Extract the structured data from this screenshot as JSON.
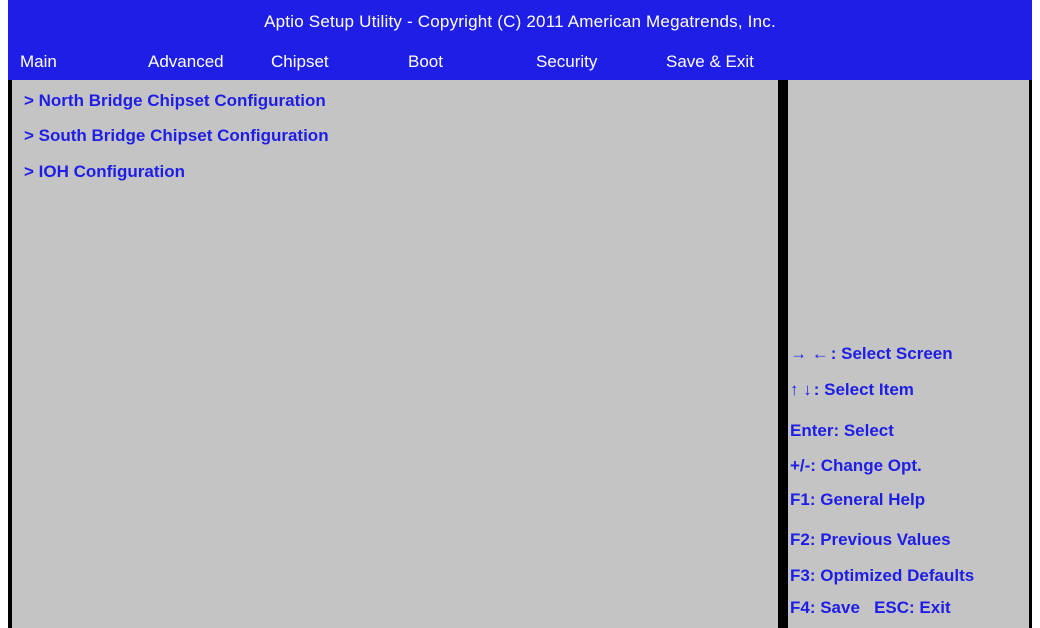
{
  "title": "Aptio Setup Utility - Copyright (C) 2011 American Megatrends, Inc.",
  "menu": [
    "Main",
    "Advanced",
    "Chipset",
    "Boot",
    "Security",
    "Save & Exit"
  ],
  "main_items": [
    "> North Bridge Chipset Configuration",
    "> South Bridge Chipset Configuration",
    "> IOH Configuration"
  ],
  "help": {
    "select_screen": ": Select Screen",
    "select_item": ": Select Item",
    "enter": "Enter: Select",
    "change_opt": "+/-: Change Opt.",
    "f1": "F1: General Help",
    "f2": "F2: Previous Values",
    "f3": "F3: Optimized Defaults",
    "f4": "F4: Save   ESC: Exit"
  },
  "colors": {
    "bar": "#1e1ee6",
    "panel": "#c4c4c4",
    "text": "#1e1ee6"
  }
}
